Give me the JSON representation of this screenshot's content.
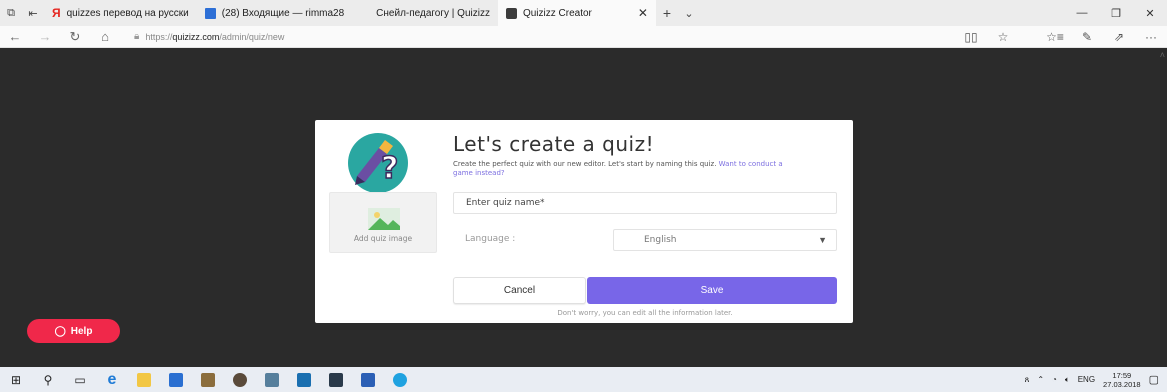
{
  "browser": {
    "tabs": [
      {
        "label": "quizzes перевод на русски"
      },
      {
        "label": "(28) Входящие — rimma28"
      },
      {
        "label": "Снейл-педагогу | Quizizz"
      },
      {
        "label": "Quizizz Creator"
      }
    ],
    "url_prefix": "https://",
    "url_host": "quizizz.com",
    "url_path": "/admin/quiz/new"
  },
  "modal": {
    "title": "Let's create a quiz!",
    "description": "Create the perfect quiz with our new editor. Let's start by naming this quiz.",
    "game_link": "Want to conduct a game instead?",
    "image_label": "Add quiz image",
    "name_placeholder": "Enter quiz name*",
    "language_label": "Language :",
    "language_value": "English",
    "cancel_label": "Cancel",
    "save_label": "Save",
    "footnote": "Don't worry, you can edit all the information later."
  },
  "help": {
    "label": "Help"
  },
  "taskbar": {
    "lang": "ENG",
    "time": "17:59",
    "date": "27.03.2018"
  },
  "colors": {
    "accent": "#7866e8",
    "help": "#f0284a",
    "backdrop": "#2b2b2b"
  }
}
